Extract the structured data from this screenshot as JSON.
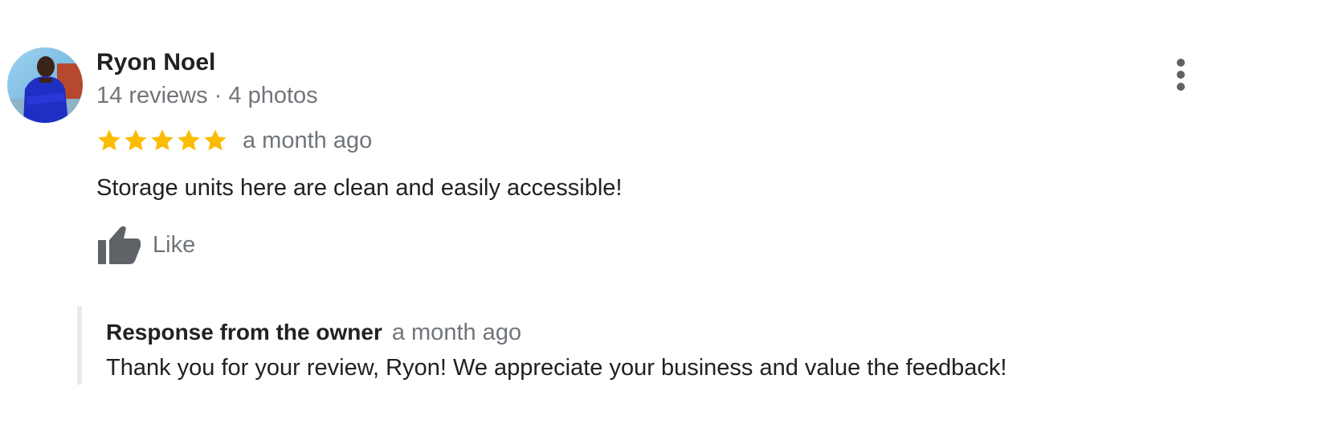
{
  "review": {
    "reviewer_name": "Ryon Noel",
    "reviewer_meta": "14 reviews · 4 photos",
    "rating": 5,
    "rating_max": 5,
    "star_color": "#fbbc04",
    "date": "a month ago",
    "text": "Storage units here are clean and easily accessible!",
    "like_label": "Like",
    "avatar_icon": "reviewer-photo",
    "more_icon": "more-vert-icon",
    "like_icon": "thumb-up-icon"
  },
  "owner_response": {
    "title": "Response from the owner",
    "date": "a month ago",
    "text": "Thank you for your review, Ryon! We appreciate your business and value the feedback!"
  },
  "colors": {
    "primary_text": "#202124",
    "secondary_text": "#70757a",
    "icon_gray": "#5f6368",
    "response_border": "#e8eaed"
  }
}
